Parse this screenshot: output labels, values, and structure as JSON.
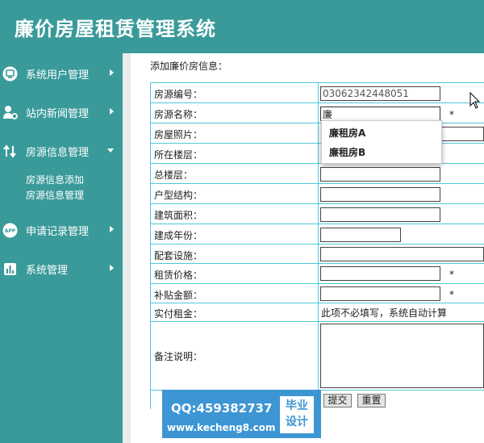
{
  "app": {
    "title": "廉价房屋租赁管理系统"
  },
  "sidebar": {
    "items": [
      {
        "label": "系统用户管理",
        "icon": "monitor-icon"
      },
      {
        "label": "站内新闻管理",
        "icon": "user-gear-icon"
      },
      {
        "label": "房源信息管理",
        "icon": "swap-arrows-icon",
        "expanded": true,
        "sub": [
          {
            "label": "房源信息添加"
          },
          {
            "label": "房源信息管理"
          }
        ]
      },
      {
        "label": "申请记录管理",
        "icon": "app-icon"
      },
      {
        "label": "系统管理",
        "icon": "bar-chart-icon"
      }
    ]
  },
  "page": {
    "heading": "添加廉价房信息："
  },
  "form": {
    "house_id": {
      "label": "房源编号：",
      "value": "03062342448051"
    },
    "house_name": {
      "label": "房源名称：",
      "value": "廉",
      "required": "*"
    },
    "photo": {
      "label": "房屋照片："
    },
    "floor": {
      "label": "所在楼层："
    },
    "total_floors": {
      "label": "总楼层："
    },
    "layout": {
      "label": "户型结构："
    },
    "area": {
      "label": "建筑面积："
    },
    "year": {
      "label": "建成年份："
    },
    "facilities": {
      "label": "配套设施："
    },
    "rent_price": {
      "label": "租赁价格：",
      "required": "*"
    },
    "subsidy": {
      "label": "补贴金额：",
      "required": "*"
    },
    "actual_rent": {
      "label": "实付租金：",
      "hint": "此项不必填写，系统自动计算"
    },
    "remark": {
      "label": "备注说明："
    },
    "submit_label": "提交",
    "reset_label": "重置"
  },
  "autocomplete": {
    "options": [
      "廉租房A",
      "廉租房B"
    ]
  },
  "watermark": {
    "qq": "QQ:459382737",
    "url": "www.kecheng8.com",
    "badge_line1": "毕业",
    "badge_line2": "设计"
  },
  "colors": {
    "sidebar": "#3a9a9a",
    "table_border": "#4fc8d8",
    "watermark": "#2f8fd0"
  }
}
